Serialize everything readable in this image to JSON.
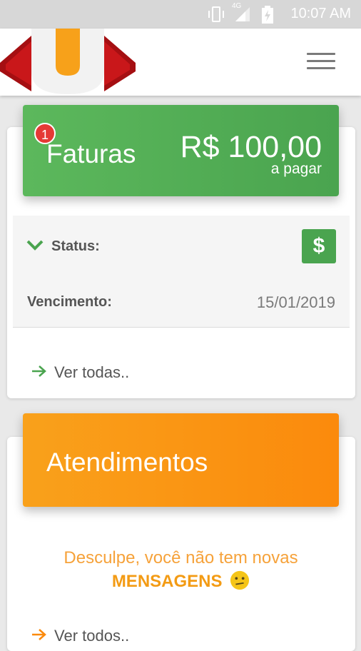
{
  "status_bar": {
    "time": "10:07 AM",
    "network": "4G",
    "icons": [
      "vibrate-icon",
      "signal-icon",
      "battery-charging-icon"
    ]
  },
  "appbar": {
    "logo": "brand-logo",
    "menu_icon": "hamburger-menu-icon"
  },
  "faturas": {
    "title": "Faturas",
    "badge_count": "1",
    "amount": "R$ 100,00",
    "amount_sub": "a pagar",
    "status_label": "Status:",
    "status_icon": "dollar-icon",
    "status_icon_text": "$",
    "due_label": "Vencimento:",
    "due_date": "15/01/2019",
    "link_label": "Ver todas..",
    "accent_color": "#4aa44f"
  },
  "atendimentos": {
    "title": "Atendimentos",
    "empty_line1": "Desculpe, você não tem novas",
    "empty_line2": "MENSAGENS",
    "emoji": "confused-face-emoji",
    "link_label": "Ver todos..",
    "accent_color": "#fb8a0c"
  }
}
